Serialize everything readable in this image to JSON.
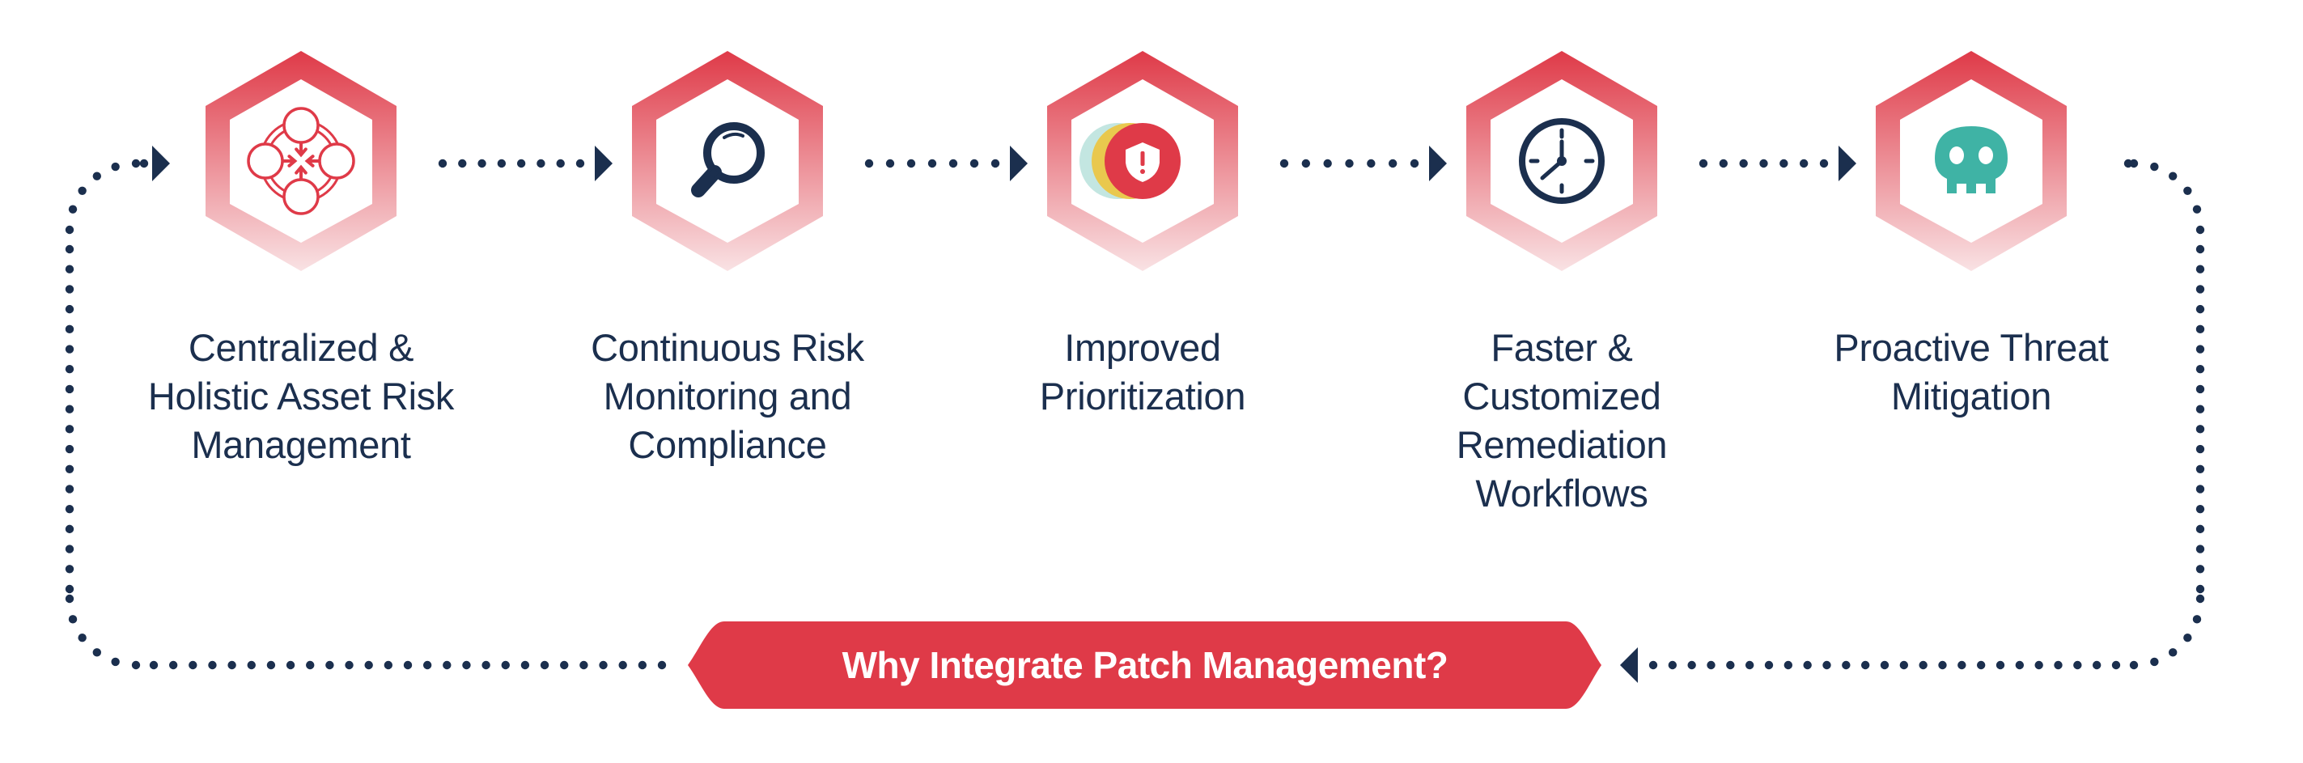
{
  "diagram": {
    "title": "Why Integrate Patch Management?",
    "colors": {
      "accent_red": "#df3a48",
      "hex_gradient_top": "#df3a48",
      "hex_gradient_bottom": "#f9e2e4",
      "navy": "#1b2f4e",
      "teal": "#3fb3a5",
      "yellow": "#e9c84e",
      "light_teal": "#c3e6e1",
      "white": "#ffffff"
    },
    "steps": [
      {
        "icon": "network-converge-icon",
        "lines": [
          "Centralized &",
          "Holistic Asset Risk",
          "Management"
        ]
      },
      {
        "icon": "magnifying-glass-icon",
        "lines": [
          "Continuous Risk",
          "Monitoring and",
          "Compliance"
        ]
      },
      {
        "icon": "shield-alert-icon",
        "lines": [
          "Improved",
          "Prioritization"
        ]
      },
      {
        "icon": "clock-icon",
        "lines": [
          "Faster &",
          "Customized",
          "Remediation",
          "Workflows"
        ]
      },
      {
        "icon": "skull-icon",
        "lines": [
          "Proactive Threat",
          "Mitigation"
        ]
      }
    ],
    "flow": "cycle: steps left-to-right, then loop back via bottom banner"
  }
}
